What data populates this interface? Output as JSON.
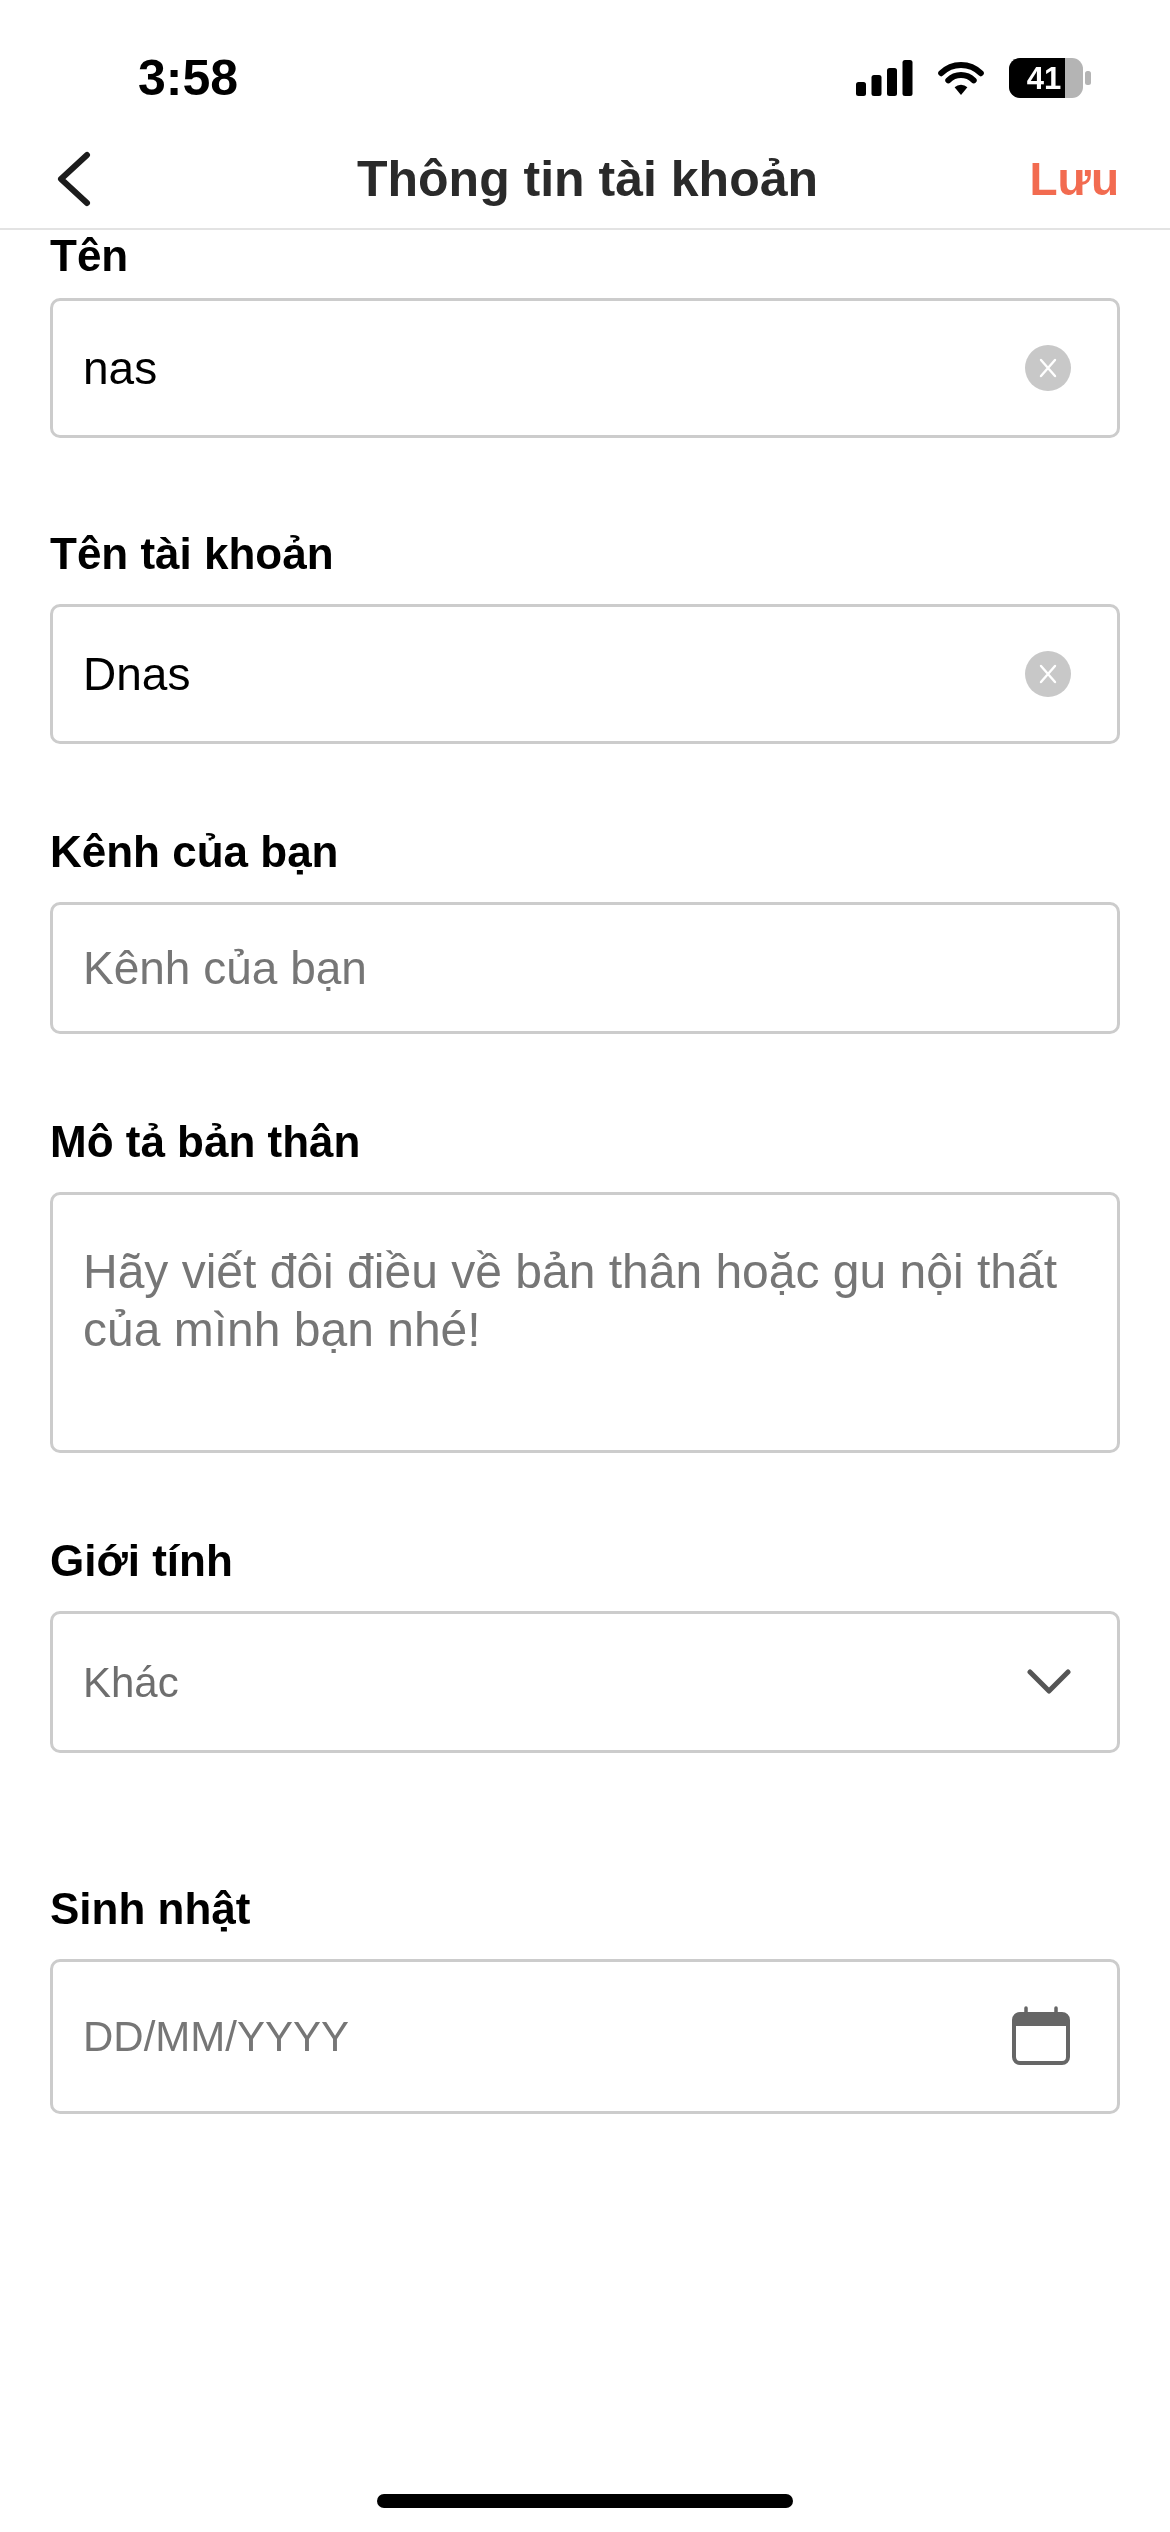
{
  "status_bar": {
    "time": "3:58",
    "battery": "41"
  },
  "nav": {
    "title": "Thông tin tài khoản",
    "action": "Lưu"
  },
  "form": {
    "fields": [
      {
        "kind": "text",
        "label": "Tên",
        "value": "nas",
        "clearable": true
      },
      {
        "kind": "text",
        "label": "Tên tài khoản",
        "value": "Dnas",
        "clearable": true
      },
      {
        "kind": "text",
        "label": "Kênh của bạn",
        "placeholder": "Kênh của bạn",
        "clearable": false
      },
      {
        "kind": "textarea",
        "label": "Mô tả bản thân",
        "placeholder": "Hãy viết đôi điều về bản thân hoặc gu nội thất của mình bạn nhé!"
      },
      {
        "kind": "select",
        "label": "Giới tính",
        "value": "Khác"
      },
      {
        "kind": "date",
        "label": "Sinh nhật",
        "placeholder": "DD/MM/YYYY"
      }
    ]
  }
}
